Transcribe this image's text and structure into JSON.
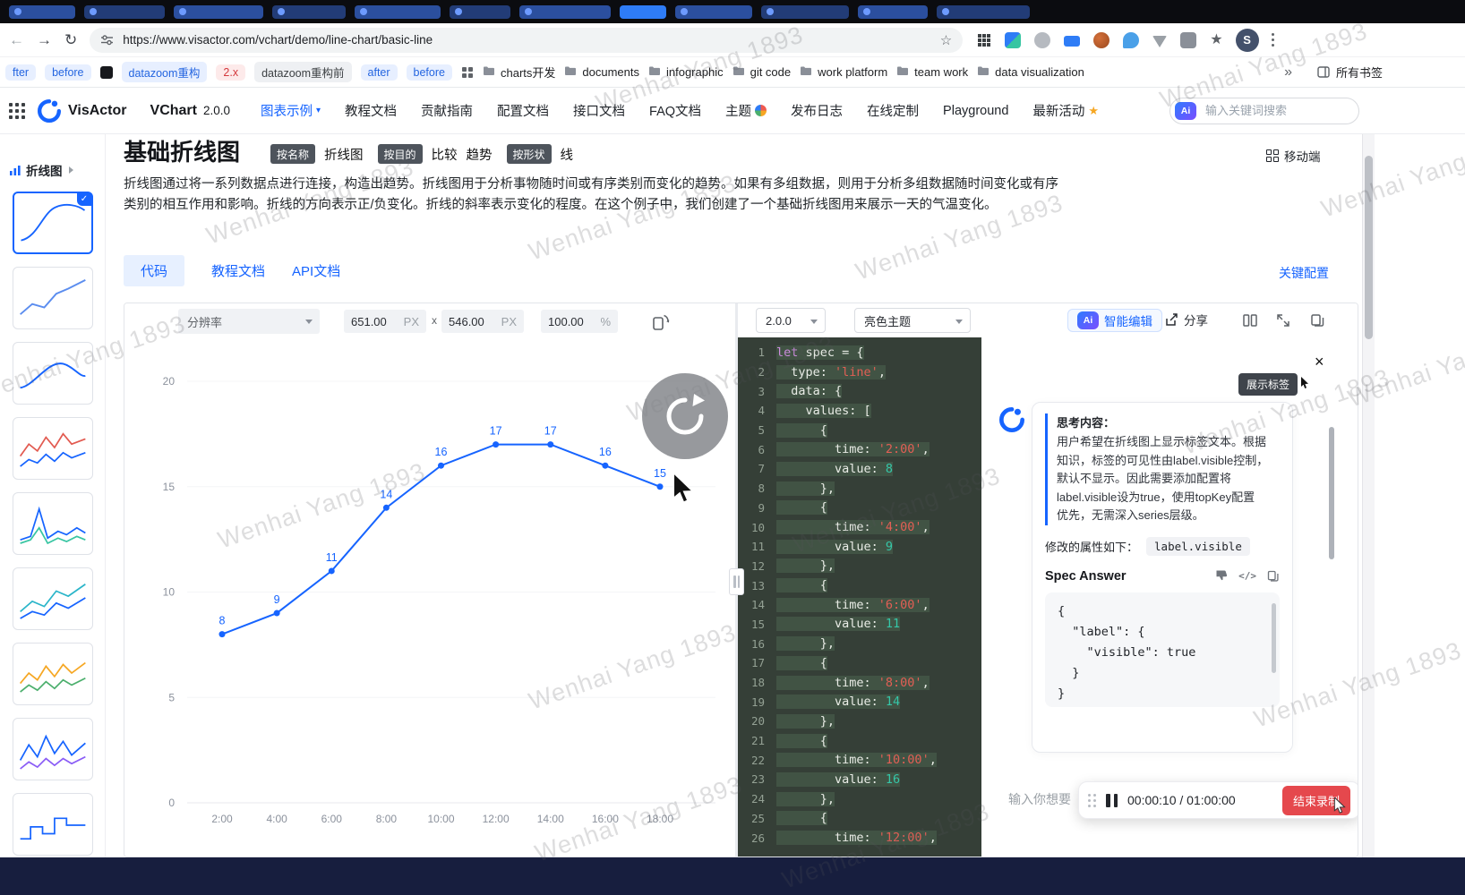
{
  "colors": {
    "accent": "#1664FF",
    "stop_red": "#E5484D"
  },
  "browser": {
    "url": "https://www.visactor.com/vchart/demo/line-chart/basic-line",
    "avatar_letter": "S",
    "bookmarks": [
      {
        "label": "fter",
        "kind": "blue"
      },
      {
        "label": "before",
        "kind": "blue"
      },
      {
        "icon": "dark-square-icon"
      },
      {
        "label": "datazoom重构",
        "kind": "blue"
      },
      {
        "label": "2.x",
        "kind": "red"
      },
      {
        "label": "datazoom重构前",
        "kind": "gray"
      },
      {
        "label": "after",
        "kind": "blue"
      },
      {
        "label": "before",
        "kind": "blue"
      },
      {
        "icon": "grid-icon"
      }
    ],
    "folders": [
      "charts开发",
      "documents",
      "infographic",
      "git code",
      "work platform",
      "team work",
      "data visualization"
    ],
    "more_symbol": "»",
    "all_bookmarks": "所有书签"
  },
  "site_header": {
    "brand": "VisActor",
    "product": "VChart",
    "version": "2.0.0",
    "ai_badge": "Ai",
    "search_placeholder": "输入关键词搜索",
    "nav": [
      {
        "label": "图表示例",
        "active": true,
        "caret": true
      },
      {
        "label": "教程文档"
      },
      {
        "label": "贡献指南"
      },
      {
        "label": "配置文档"
      },
      {
        "label": "接口文档"
      },
      {
        "label": "FAQ文档"
      },
      {
        "label": "主题",
        "icon": "palette-icon"
      },
      {
        "label": "发布日志"
      },
      {
        "label": "在线定制"
      },
      {
        "label": "Playground"
      },
      {
        "label": "最新活动",
        "icon": "star-icon"
      }
    ]
  },
  "sidebar": {
    "section": "折线图"
  },
  "page": {
    "title": "基础折线图",
    "tag_groups": [
      {
        "label": "按名称",
        "values": [
          "折线图"
        ]
      },
      {
        "label": "按目的",
        "values": [
          "比较",
          "趋势"
        ]
      },
      {
        "label": "按形状",
        "values": [
          "线"
        ]
      }
    ],
    "mobile_label": "移动端",
    "description": [
      "折线图通过将一系列数据点进行连接，构造出趋势。折线图用于分析事物随时间或有序类别而变化的趋势。如果有多组数据，则用于分析多组数据随时间变化或有序",
      "类别的相互作用和影响。折线的方向表示正/负变化。折线的斜率表示变化的程度。在这个例子中，我们创建了一个基础折线图用来展示一天的气温变化。"
    ],
    "tabs": [
      "代码",
      "教程文档",
      "API文档"
    ],
    "key_config": "关键配置"
  },
  "chart_toolbar": {
    "resolution": "分辨率",
    "width": "651.00",
    "width_unit": "PX",
    "times": "x",
    "height": "546.00",
    "height_unit": "PX",
    "zoom": "100.00",
    "zoom_unit": "%"
  },
  "chart_data": {
    "type": "line",
    "x": [
      "2:00",
      "4:00",
      "6:00",
      "8:00",
      "10:00",
      "12:00",
      "14:00",
      "16:00",
      "18:00"
    ],
    "values": [
      8,
      9,
      11,
      14,
      16,
      17,
      17,
      16,
      15
    ],
    "ylim": [
      0,
      20
    ],
    "yticks": [
      0,
      5,
      10,
      15,
      20
    ],
    "line_color": "#1664FF",
    "label_color": "#1664FF",
    "grid": true,
    "legend": "none",
    "title": ""
  },
  "code_toolbar": {
    "version": "2.0.0",
    "theme": "亮色主题",
    "ai_badge": "Ai",
    "ai_edit": "智能编辑",
    "share": "分享"
  },
  "editor": {
    "lines": [
      "let spec = {",
      "  type: 'line',",
      "  data: {",
      "    values: [",
      "      {",
      "        time: '2:00',",
      "        value: 8",
      "      },",
      "      {",
      "        time: '4:00',",
      "        value: 9",
      "      },",
      "      {",
      "        time: '6:00',",
      "        value: 11",
      "      },",
      "      {",
      "        time: '8:00',",
      "        value: 14",
      "      },",
      "      {",
      "        time: '10:00',",
      "        value: 16",
      "      },",
      "      {",
      "        time: '12:00',"
    ]
  },
  "ai_panel": {
    "chip": "展示标签",
    "thinking_title": "思考内容：",
    "thinking_lines": [
      "用户希望在折线图上显示标签文本。根据",
      "知识，标签的可见性由label.visible控制，",
      "默认不显示。因此需要添加配置将",
      "label.visible设为true，使用topKey配置",
      "优先，无需深入series层级。"
    ],
    "modified_label": "修改的属性如下：",
    "modified_prop": "label.visible",
    "answer_title": "Spec Answer",
    "answer_code_lines": [
      "{",
      "  \"label\": {",
      "    \"visible\": true",
      "  }",
      "}"
    ],
    "input_placeholder": "输入你想要",
    "recording": {
      "time": "00:00:10 / 01:00:00",
      "stop": "结束录制"
    }
  },
  "watermark": {
    "text": "Wenhai Yang 1893"
  }
}
